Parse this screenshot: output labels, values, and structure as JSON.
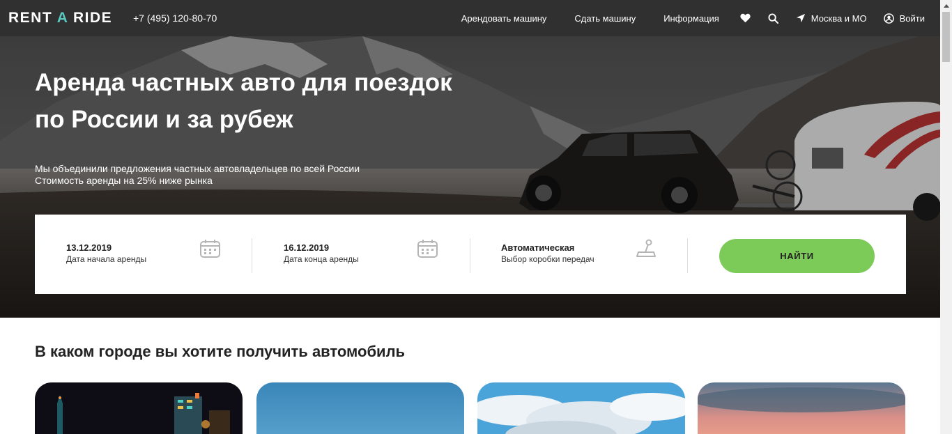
{
  "header": {
    "logo_left": "RENT ",
    "logo_accent": "A",
    "logo_right": " RIDE",
    "phone": "+7 (495) 120-80-70",
    "nav": [
      "Арендовать машину",
      "Сдать машину",
      "Информация"
    ],
    "location": "Москва и МО",
    "login": "Войти"
  },
  "hero": {
    "title_line1": "Аренда частных авто для поездок",
    "title_line2": "по России и за рубеж",
    "sub_line1": "Мы объединили предложения частных автовладельцев по всей России",
    "sub_line2": "Стоимость аренды на 25% ниже рынка"
  },
  "search": {
    "start_date": "13.12.2019",
    "start_label": "Дата начала аренды",
    "end_date": "16.12.2019",
    "end_label": "Дата конца аренды",
    "transmission": "Автоматическая",
    "transmission_label": "Выбор коробки передач",
    "button": "НАЙТИ"
  },
  "section": {
    "title": "В каком городе вы хотите получить автомобиль"
  },
  "icons": {
    "calendar": "calendar-icon",
    "gearbox": "gearbox-icon",
    "favorite": "heart-icon",
    "search": "search-icon",
    "location": "location-arrow-icon",
    "user": "user-icon"
  },
  "colors": {
    "header_bg": "#303030",
    "logo_accent": "#5bc8c0",
    "button_green": "#7ccb59"
  }
}
